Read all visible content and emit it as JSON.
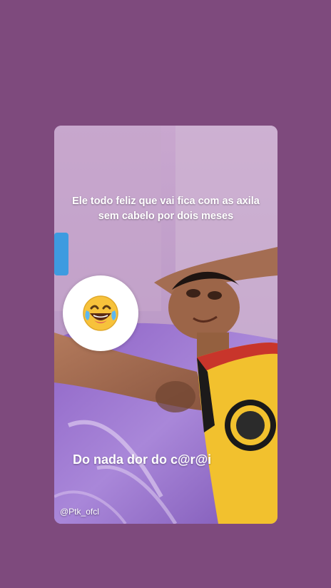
{
  "story": {
    "caption_top": "Ele todo feliz que vai fica com as axila sem cabelo por dois meses",
    "caption_bottom": "Do nada dor do c@r@i",
    "watermark": "@Ptk_ofcl",
    "sticker_icon": "laughing-tears-emoji-icon"
  },
  "colors": {
    "background": "#7e4a7d",
    "jersey": "#f2c12e",
    "text": "#ffffff"
  }
}
